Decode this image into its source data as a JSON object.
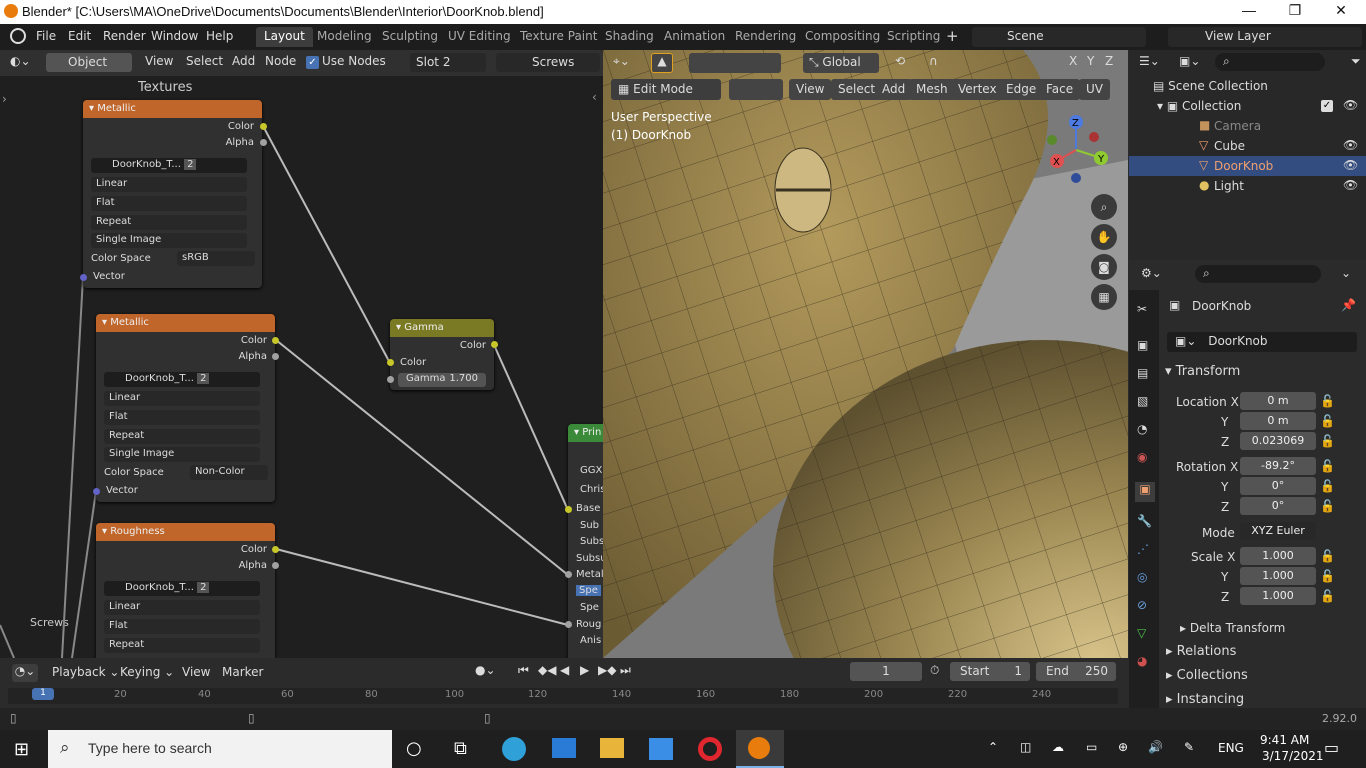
{
  "window": {
    "title": "Blender* [C:\\Users\\MA\\OneDrive\\Documents\\Documents\\Blender\\Interior\\DoorKnob.blend]"
  },
  "menu": [
    "File",
    "Edit",
    "Render",
    "Window",
    "Help"
  ],
  "workspaces": [
    "Layout",
    "Modeling",
    "Sculpting",
    "UV Editing",
    "Texture Paint",
    "Shading",
    "Animation",
    "Rendering",
    "Compositing",
    "Scripting"
  ],
  "scene": "Scene",
  "view_layer": "View Layer",
  "node_editor": {
    "mode": "Object",
    "view": "View",
    "select": "Select",
    "add": "Add",
    "node": "Node",
    "use_nodes": "Use Nodes",
    "slot": "Slot 2",
    "material": "Screws",
    "frame_label": "Textures",
    "screws_label": "Screws",
    "nodes": [
      {
        "title": "Metallic",
        "image": "DoorKnob_T...",
        "users": "2",
        "interp": "Linear",
        "proj": "Flat",
        "ext": "Repeat",
        "src": "Single Image",
        "cs_label": "Color Space",
        "cs": "sRGB",
        "out_color": "Color",
        "out_alpha": "Alpha",
        "in_vector": "Vector"
      },
      {
        "title": "Metallic",
        "image": "DoorKnob_T...",
        "users": "2",
        "interp": "Linear",
        "proj": "Flat",
        "ext": "Repeat",
        "src": "Single Image",
        "cs_label": "Color Space",
        "cs": "Non-Color",
        "out_color": "Color",
        "out_alpha": "Alpha",
        "in_vector": "Vector"
      },
      {
        "title": "Roughness",
        "image": "DoorKnob_T...",
        "users": "2",
        "interp": "Linear",
        "proj": "Flat",
        "ext": "Repeat",
        "out_color": "Color",
        "out_alpha": "Alpha"
      }
    ],
    "gamma": {
      "title": "Gamma",
      "out": "Color",
      "in": "Color",
      "field": "Gamma",
      "value": "1.700"
    },
    "principled": {
      "title": "Prin",
      "rows": [
        "GGX",
        "Chris",
        "Base",
        "Sub",
        "Subs",
        "Subsu",
        "Metal",
        "Spe",
        "Spe",
        "Roug",
        "Anis"
      ]
    }
  },
  "viewport": {
    "mode": "Edit Mode",
    "menus": [
      "View",
      "Select",
      "Add",
      "Mesh",
      "Vertex",
      "Edge",
      "Face",
      "UV"
    ],
    "orientation": "Global",
    "perspective": "User Perspective",
    "object": "(1) DoorKnob",
    "axes": {
      "x": "X",
      "y": "Y",
      "z": "Z"
    }
  },
  "outliner": {
    "root": "Scene Collection",
    "collection": "Collection",
    "items": [
      {
        "name": "Camera",
        "color": "#888888"
      },
      {
        "name": "Cube",
        "color": "#e0e0e0"
      },
      {
        "name": "DoorKnob",
        "color": "#f0a070",
        "selected": true
      },
      {
        "name": "Light",
        "color": "#e0e0e0"
      }
    ]
  },
  "properties": {
    "object": "DoorKnob",
    "name_field": "DoorKnob",
    "transform": "Transform",
    "location": [
      {
        "label": "Location X",
        "value": "0 m"
      },
      {
        "label": "Y",
        "value": "0 m"
      },
      {
        "label": "Z",
        "value": "0.023069"
      }
    ],
    "rotation": [
      {
        "label": "Rotation X",
        "value": "-89.2°"
      },
      {
        "label": "Y",
        "value": "0°"
      },
      {
        "label": "Z",
        "value": "0°"
      }
    ],
    "mode_label": "Mode",
    "mode": "XYZ Euler",
    "scale": [
      {
        "label": "Scale X",
        "value": "1.000"
      },
      {
        "label": "Y",
        "value": "1.000"
      },
      {
        "label": "Z",
        "value": "1.000"
      }
    ],
    "delta": "Delta Transform",
    "relations": "Relations",
    "collections": "Collections",
    "instancing": "Instancing"
  },
  "timeline": {
    "playback": "Playback",
    "keying": "Keying",
    "view": "View",
    "marker": "Marker",
    "frame": "1",
    "start_label": "Start",
    "start": "1",
    "end_label": "End",
    "end": "250",
    "ticks": [
      "1",
      "20",
      "40",
      "60",
      "80",
      "100",
      "120",
      "140",
      "160",
      "180",
      "200",
      "220",
      "240"
    ]
  },
  "status": {
    "version": "2.92.0"
  },
  "taskbar": {
    "search": "Type here to search",
    "lang": "ENG",
    "time": "9:41 AM",
    "date": "3/17/2021"
  }
}
